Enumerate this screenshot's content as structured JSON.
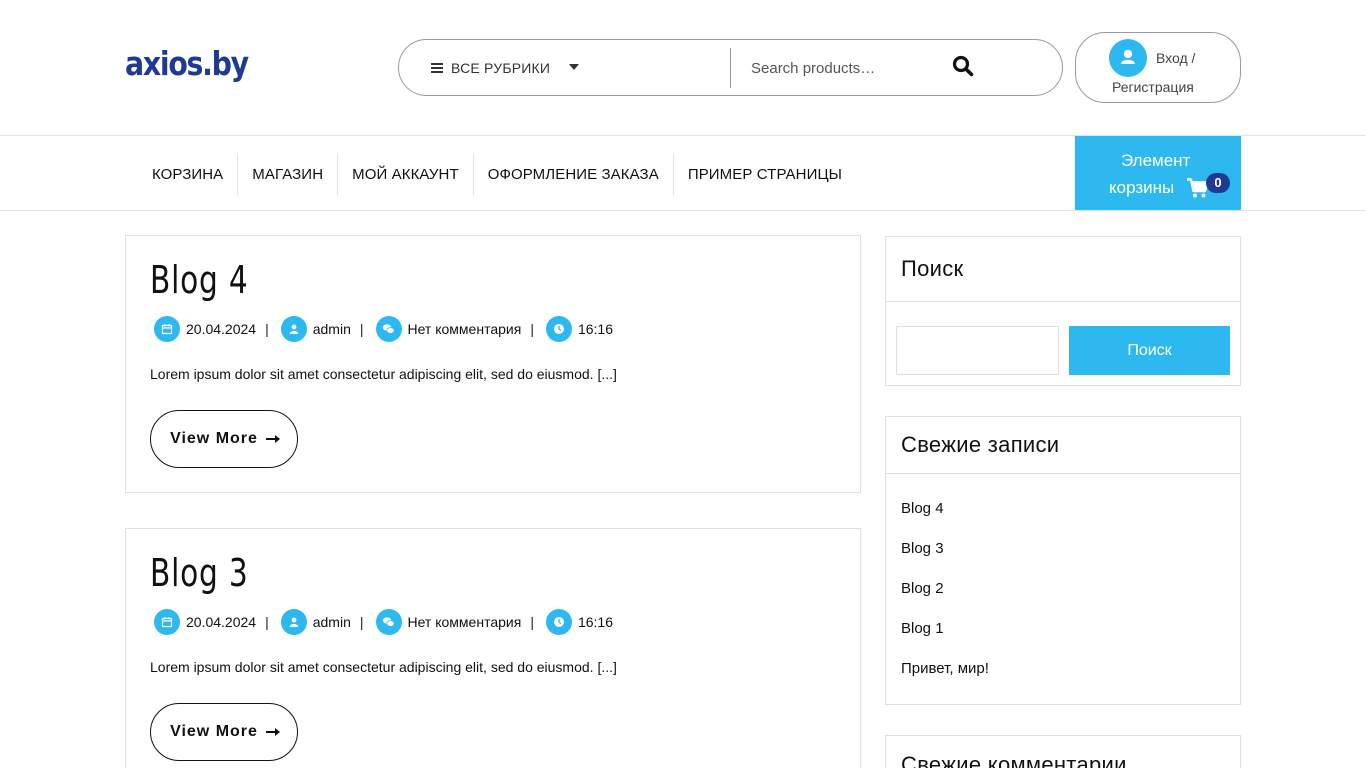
{
  "header": {
    "logo": "axios.by",
    "categories_label": "ВСЕ РУБРИКИ",
    "search_placeholder": "Search products…",
    "login_line1": "Вход /",
    "login_line2": "Регистрация"
  },
  "nav": {
    "items": [
      {
        "label": "КОРЗИНА"
      },
      {
        "label": "МАГАЗИН"
      },
      {
        "label": "МОЙ АККАУНТ"
      },
      {
        "label": "ОФОРМЛЕНИЕ ЗАКАЗА"
      },
      {
        "label": "ПРИМЕР СТРАНИЦЫ"
      }
    ],
    "cart_line1": "Элемент",
    "cart_line2": "корзины",
    "cart_count": "0"
  },
  "posts": [
    {
      "title": "Blog 4",
      "date": "20.04.2024",
      "author": "admin",
      "comments": "Нет комментария",
      "time": "16:16",
      "excerpt": "Lorem ipsum dolor sit amet consectetur adipiscing elit, sed do eiusmod. [...]",
      "button": "View More"
    },
    {
      "title": "Blog 3",
      "date": "20.04.2024",
      "author": "admin",
      "comments": "Нет комментария",
      "time": "16:16",
      "excerpt": "Lorem ipsum dolor sit amet consectetur adipiscing elit, sed do eiusmod. [...]",
      "button": "View More"
    }
  ],
  "sidebar": {
    "search_title": "Поиск",
    "search_button": "Поиск",
    "recent_title": "Свежие записи",
    "recent_items": [
      "Blog 4",
      "Blog 3",
      "Blog 2",
      "Blog 1",
      "Привет, мир!"
    ],
    "comments_title": "Свежие комментарии"
  },
  "colors": {
    "accent": "#2db8f0",
    "brand": "#1f3a93"
  },
  "icons": {
    "categories": "menu-icon",
    "search": "search-icon",
    "login": "user-icon",
    "cart": "cart-icon",
    "date": "calendar-icon",
    "author": "user-icon",
    "comments": "comments-icon",
    "time": "clock-icon"
  }
}
